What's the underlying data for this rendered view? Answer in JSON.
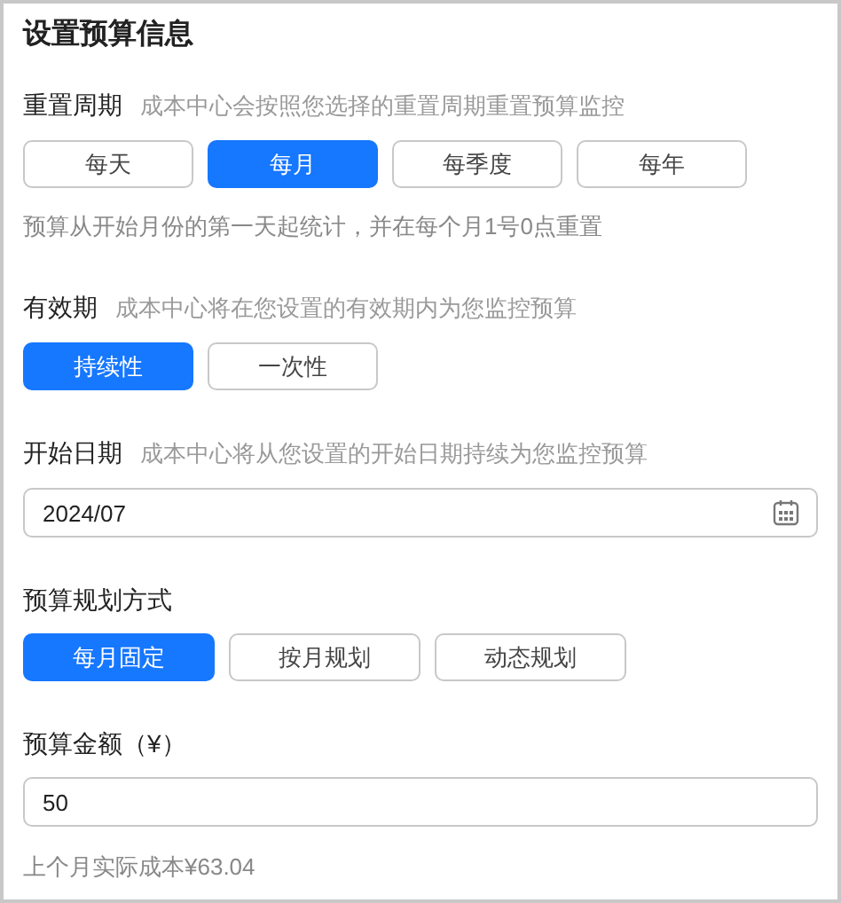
{
  "title": "设置预算信息",
  "sections": [
    {
      "kind": "options",
      "label": "重置周期",
      "hint": "成本中心会按照您选择的重置周期重置预算监控",
      "options": [
        {
          "label": "每天",
          "selected": false
        },
        {
          "label": "每月",
          "selected": true
        },
        {
          "label": "每季度",
          "selected": false
        },
        {
          "label": "每年",
          "selected": false
        }
      ],
      "note": "预算从开始月份的第一天起统计，并在每个月1号0点重置"
    },
    {
      "kind": "options",
      "label": "有效期",
      "hint": "成本中心将在您设置的有效期内为您监控预算",
      "options": [
        {
          "label": "持续性",
          "selected": true
        },
        {
          "label": "一次性",
          "selected": false
        }
      ]
    },
    {
      "kind": "date",
      "label": "开始日期",
      "hint": "成本中心将从您设置的开始日期持续为您监控预算",
      "value": "2024/07"
    },
    {
      "kind": "options",
      "label": "预算规划方式",
      "options": [
        {
          "label": "每月固定",
          "selected": true
        },
        {
          "label": "按月规划",
          "selected": false
        },
        {
          "label": "动态规划",
          "selected": false
        }
      ]
    },
    {
      "kind": "number",
      "label": "预算金额（¥）",
      "value": "50",
      "note": "上个月实际成本¥63.04"
    }
  ]
}
